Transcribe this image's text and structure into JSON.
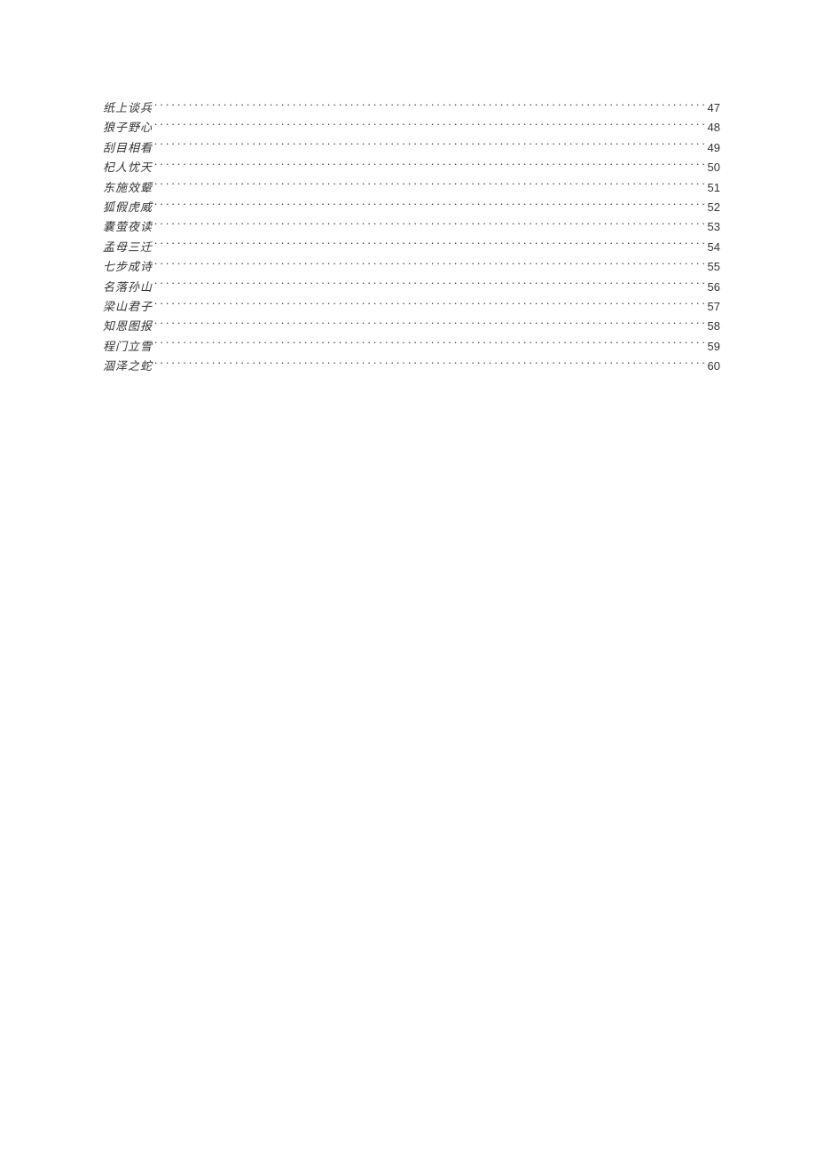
{
  "toc": {
    "entries": [
      {
        "title": "纸上谈兵",
        "page": "47"
      },
      {
        "title": "狼子野心",
        "page": "48"
      },
      {
        "title": "刮目相看",
        "page": "49"
      },
      {
        "title": "杞人忧天",
        "page": "50"
      },
      {
        "title": "东施效颦",
        "page": "51"
      },
      {
        "title": "狐假虎威",
        "page": "52"
      },
      {
        "title": "囊萤夜读",
        "page": "53"
      },
      {
        "title": "孟母三迁",
        "page": "54"
      },
      {
        "title": "七步成诗",
        "page": "55"
      },
      {
        "title": "名落孙山",
        "page": "56"
      },
      {
        "title": "梁山君子",
        "page": "57"
      },
      {
        "title": "知恩图报",
        "page": "58"
      },
      {
        "title": "程门立雪",
        "page": "59"
      },
      {
        "title": "涸泽之蛇",
        "page": "60"
      }
    ]
  }
}
